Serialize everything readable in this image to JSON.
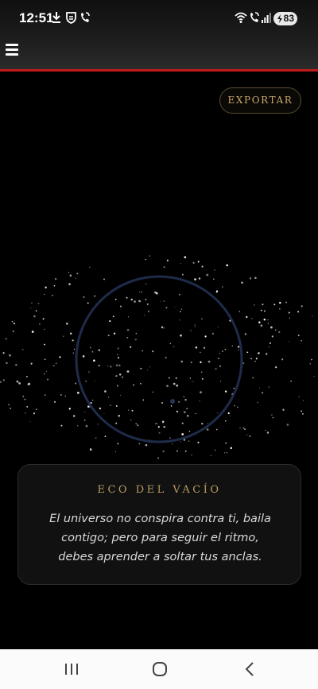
{
  "status_bar": {
    "time": "12:51",
    "battery": "83",
    "icons": [
      "download-icon",
      "shield-icon",
      "wifi-call-icon",
      "wifi-icon",
      "signal-icon",
      "battery-icon"
    ]
  },
  "toolbar": {
    "menu_icon": "hamburger-icon",
    "accent_color": "#c21b1b"
  },
  "main": {
    "export_label": "EXPORTAR",
    "quote": {
      "title": "ECO DEL VACÍO",
      "text": "El universo no conspira contra ti, baila contigo; pero para seguir el ritmo, debes aprender a soltar tus anclas."
    }
  },
  "nav_bar": {
    "buttons": [
      "recents-icon",
      "home-icon",
      "back-icon"
    ]
  },
  "colors": {
    "background": "#000000",
    "gold": "#b99a5e",
    "ring": "#1e2c4a"
  }
}
